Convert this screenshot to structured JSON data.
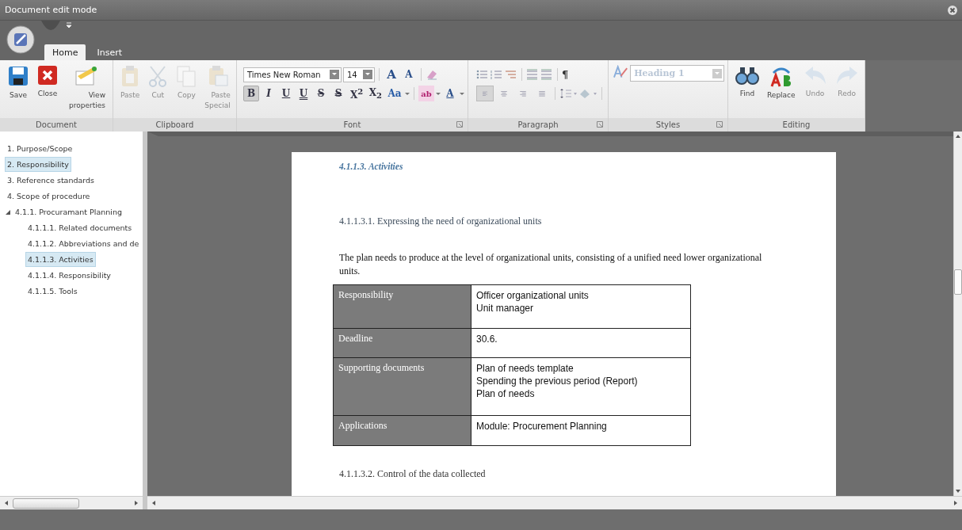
{
  "window": {
    "title": "Document edit mode"
  },
  "tabs": [
    {
      "label": "Home",
      "selected": true
    },
    {
      "label": "Insert",
      "selected": false
    }
  ],
  "ribbon": {
    "groups": [
      {
        "kind": "document",
        "label": "Document",
        "launcher": false,
        "buttons": [
          {
            "kind": "save",
            "label": "Save",
            "disabled": false
          },
          {
            "kind": "close",
            "label": "Close",
            "disabled": false
          },
          {
            "kind": "properties",
            "label": "View properties",
            "disabled": false
          }
        ]
      },
      {
        "kind": "clipboard",
        "label": "Clipboard",
        "launcher": false,
        "buttons": [
          {
            "kind": "paste",
            "label": "Paste",
            "disabled": true
          },
          {
            "kind": "cut",
            "label": "Cut",
            "disabled": true
          },
          {
            "kind": "copy",
            "label": "Copy",
            "disabled": true
          },
          {
            "kind": "paste-special",
            "label": "Paste Special",
            "disabled": true
          }
        ]
      },
      {
        "kind": "font",
        "label": "Font",
        "launcher": true,
        "font_name": "Times New Roman",
        "font_size": "14",
        "size_buttons": [
          "A",
          "A"
        ],
        "format_buttons": [
          {
            "kind": "bold",
            "text": "B",
            "selected": true
          },
          {
            "kind": "italic",
            "text": "I",
            "selected": false
          },
          {
            "kind": "underline",
            "text": "U",
            "selected": false
          },
          {
            "kind": "double-underline",
            "text": "U",
            "selected": false
          },
          {
            "kind": "strike",
            "text": "S",
            "selected": false
          },
          {
            "kind": "double-strike",
            "text": "S",
            "selected": false
          },
          {
            "kind": "superscript",
            "text": "X$^{2}$",
            "selected": false
          },
          {
            "kind": "subscript",
            "text": "X$_{2}$",
            "selected": false
          },
          {
            "kind": "case",
            "text": "Aa",
            "selected": false
          },
          {
            "kind": "highlight",
            "text": "ab",
            "selected": false
          },
          {
            "kind": "color",
            "text": "A",
            "selected": false
          }
        ]
      },
      {
        "kind": "paragraph",
        "label": "Paragraph",
        "launcher": true,
        "pilcrow": "¶",
        "align_buttons": [
          {
            "kind": "left",
            "selected": true
          },
          {
            "kind": "center",
            "selected": false
          },
          {
            "kind": "right",
            "selected": false
          },
          {
            "kind": "justify",
            "selected": false
          }
        ]
      },
      {
        "kind": "styles",
        "label": "Styles",
        "launcher": true,
        "style": "Heading 1",
        "disabled": true
      },
      {
        "kind": "editing",
        "label": "Editing",
        "launcher": false,
        "buttons": [
          {
            "kind": "find",
            "label": "Find",
            "disabled": false
          },
          {
            "kind": "replace",
            "label": "Replace",
            "disabled": false
          },
          {
            "kind": "undo",
            "label": "Undo",
            "disabled": true
          },
          {
            "kind": "redo",
            "label": "Redo",
            "disabled": true
          }
        ]
      }
    ]
  },
  "outline": {
    "items": [
      {
        "label": "1. Purpose/Scope",
        "selected": false
      },
      {
        "label": "2. Responsibility",
        "selected": true
      },
      {
        "label": "3. Reference standards",
        "selected": false
      },
      {
        "label": "4. Scope of procedure",
        "selected": false
      },
      {
        "label": "4.1.1. Procuramant Planning",
        "selected": false,
        "expanded": true,
        "children": [
          {
            "label": "4.1.1.1. Related documents",
            "selected": false
          },
          {
            "label": "4.1.1.2. Abbreviations and de",
            "selected": false
          },
          {
            "label": "4.1.1.3. Activities",
            "selected": true
          },
          {
            "label": "4.1.1.4. Responsibility",
            "selected": false
          },
          {
            "label": "4.1.1.5. Tools",
            "selected": false
          }
        ]
      }
    ]
  },
  "document": {
    "heading": "4.1.1.3. Activities",
    "subheading": "4.1.1.3.1. Expressing the need of organizational units",
    "paragraph": "The plan needs to produce at the level of organizational units, consisting of a unified need lower organizational units.",
    "table": {
      "rows": [
        {
          "label": "Responsibility",
          "values": [
            "Officer organizational units",
            "Unit manager"
          ]
        },
        {
          "label": "Deadline",
          "values": [
            "30.6."
          ]
        },
        {
          "label": "Supporting documents",
          "values": [
            "Plan of needs template",
            "Spending the previous period (Report)",
            "Plan of needs"
          ]
        },
        {
          "label": "Applications",
          "values": [
            "Module: Procurement Planning"
          ]
        }
      ]
    },
    "next_heading": "4.1.1.3.2. Control of the data collected"
  }
}
